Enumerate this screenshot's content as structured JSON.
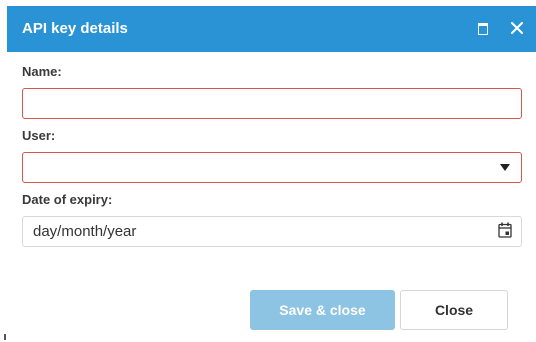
{
  "dialog": {
    "title": "API key details"
  },
  "form": {
    "name_label": "Name:",
    "name_value": "",
    "user_label": "User:",
    "user_value": "",
    "expiry_label": "Date of expiry:",
    "expiry_value": "day/month/year"
  },
  "buttons": {
    "save_close_label": "Save & close",
    "close_label": "Close"
  },
  "icons": {
    "maximize": "maximize-icon",
    "close": "close-icon",
    "dropdown": "chevron-down-icon",
    "calendar": "calendar-icon"
  },
  "colors": {
    "header": "#2a93d5",
    "primary_disabled": "#8dc3e3",
    "invalid_border": "#d9534f"
  }
}
